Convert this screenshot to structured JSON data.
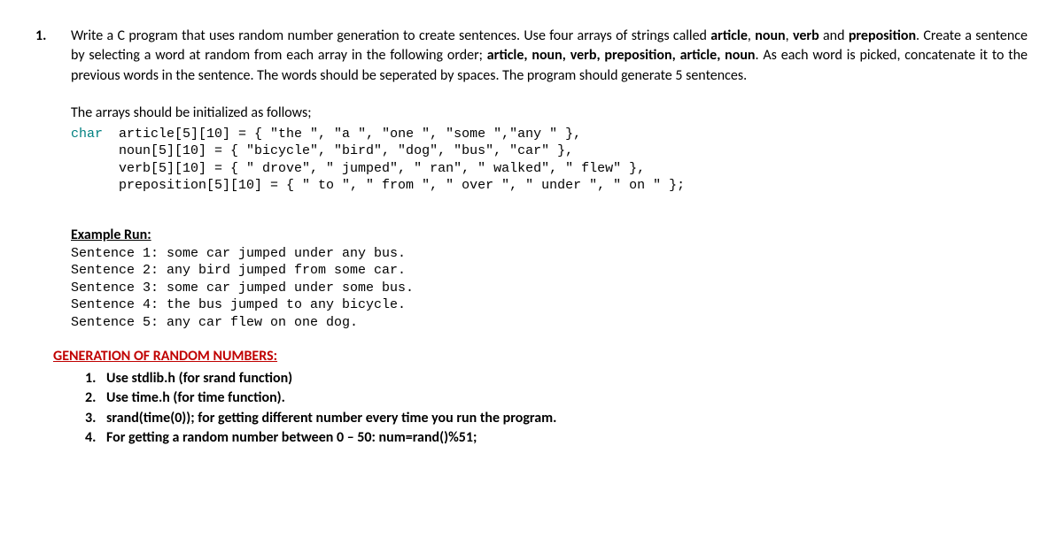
{
  "question": {
    "number": "1.",
    "p1_a": "Write a C program that uses random number generation to create sentences. Use four arrays of strings called ",
    "bold1": "article",
    "p1_b": ", ",
    "bold2": "noun",
    "p1_c": ", ",
    "bold3": "verb",
    "p1_d": " and ",
    "bold4": "preposition",
    "p1_e": ". Create a sentence by selecting a word at random from each array in the following order; ",
    "bold5": "article, noun, verb, preposition, article, noun",
    "p1_f": ". As each word is picked, concatenate it to the previous words in the sentence. The words should be seperated by spaces. The program should generate 5 sentences."
  },
  "arrays": {
    "title": "The arrays should be initialized as follows;",
    "line1_kw": "char",
    "line1_rest": "  article[5][10] = { \"the \", \"a \", \"one \", \"some \",\"any \" },",
    "line2": "      noun[5][10] = { \"bicycle\", \"bird\", \"dog\", \"bus\", \"car\" },",
    "line3": "      verb[5][10] = { \" drove\", \" jumped\", \" ran\", \" walked\", \" flew\" },",
    "line4": "      preposition[5][10] = { \" to \", \" from \", \" over \", \" under \", \" on \" };"
  },
  "example": {
    "title": "Example Run:",
    "lines": [
      "Sentence 1: some car jumped under any bus.",
      "Sentence 2: any bird jumped from some car.",
      "Sentence 3: some car jumped under some bus.",
      "Sentence 4: the bus jumped to any bicycle.",
      "Sentence 5: any car flew on one dog."
    ]
  },
  "generation": {
    "title": "GENERATION OF RANDOM NUMBERS:",
    "items": [
      "Use stdlib.h (for srand function)",
      "Use time.h (for time function).",
      "srand(time(0));  for getting different number every time you run the program.",
      "For getting a random number between 0 – 50: num=rand()%51;"
    ]
  }
}
